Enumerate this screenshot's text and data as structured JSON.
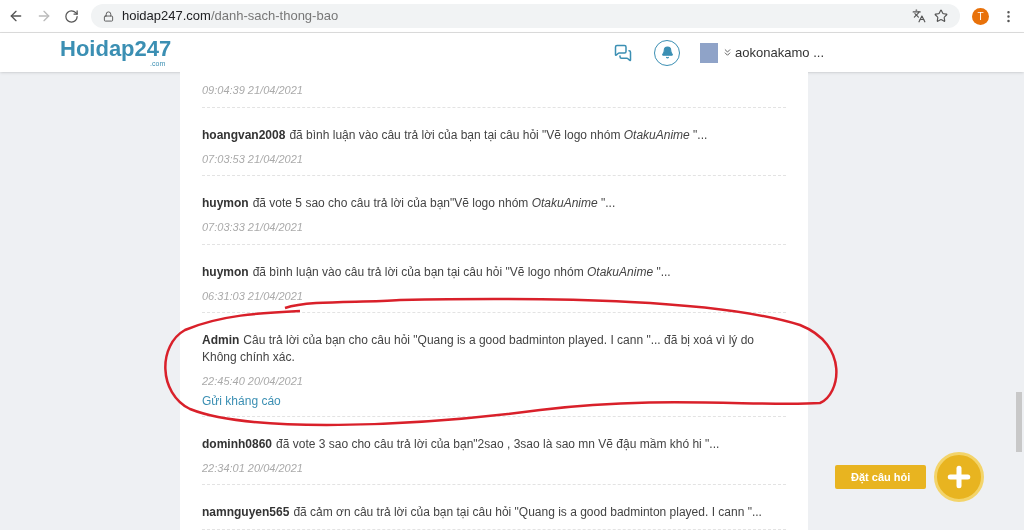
{
  "browser": {
    "url_domain": "hoidap247.com",
    "url_path": "/danh-sach-thong-bao",
    "profile_initial": "T"
  },
  "header": {
    "logo": "Hoidap247",
    "logo_suffix": ".com",
    "username": "aokonakamo ..."
  },
  "notifications": [
    {
      "time": "09:04:39 21/04/2021"
    },
    {
      "user": "hoangvan2008",
      "text": "đã bình luận vào câu trả lời của bạn tại câu hỏi \"Vẽ logo nhóm *OtakuAnime* \"...",
      "time": "07:03:53 21/04/2021"
    },
    {
      "user": "huymon",
      "text": "đã vote 5 sao cho câu trả lời của bạn\"Vẽ logo nhóm *OtakuAnime* \"...",
      "time": "07:03:33 21/04/2021"
    },
    {
      "user": "huymon",
      "text": "đã bình luận vào câu trả lời của bạn tại câu hỏi \"Vẽ logo nhóm *OtakuAnime* \"...",
      "time": "06:31:03 21/04/2021"
    },
    {
      "user": "Admin",
      "text": "Câu trả lời của bạn cho câu hỏi \"Quang is a good badminton played. I cann \"... đã bị xoá vì lý do Không chính xác.",
      "time": "22:45:40 20/04/2021",
      "link": "Gửi kháng cáo",
      "circled": true
    },
    {
      "user": "dominh0860",
      "text": "đã vote 3 sao cho câu trả lời của bạn\"2sao , 3sao là sao mn Vẽ đậu mầm khó hi \"...",
      "time": "22:34:01 20/04/2021"
    },
    {
      "user": "namnguyen565",
      "text": "đã cảm ơn câu trả lời của bạn tại câu hỏi \"Quang is a good badminton played. I cann \"..."
    }
  ],
  "fab": {
    "label": "Đặt câu hỏi"
  }
}
